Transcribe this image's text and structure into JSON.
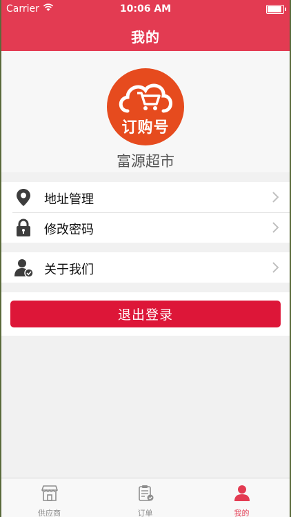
{
  "status_bar": {
    "carrier": "Carrier",
    "time": "10:06 AM"
  },
  "header": {
    "title": "我的"
  },
  "profile": {
    "logo_text": "订购号",
    "store_name": "富源超市"
  },
  "menu": {
    "group1": [
      {
        "label": "地址管理",
        "icon": "location-pin-icon"
      },
      {
        "label": "修改密码",
        "icon": "lock-icon"
      }
    ],
    "group2": [
      {
        "label": "关于我们",
        "icon": "user-check-icon"
      }
    ]
  },
  "logout": {
    "label": "退出登录"
  },
  "tabbar": {
    "items": [
      {
        "label": "供应商",
        "icon": "store-icon",
        "active": false
      },
      {
        "label": "订单",
        "icon": "clipboard-icon",
        "active": false
      },
      {
        "label": "我的",
        "icon": "person-icon",
        "active": true
      }
    ]
  },
  "colors": {
    "brand": "#e33b52",
    "logout": "#dd1638",
    "logo": "#e64b1e"
  }
}
